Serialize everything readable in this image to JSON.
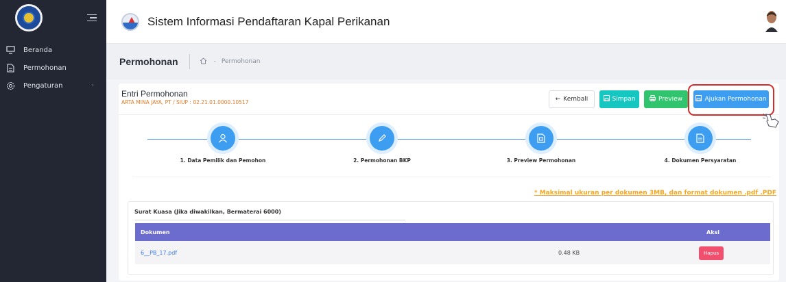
{
  "sidebar": {
    "logo": "emblem-logo",
    "menu_icon": "hamburger-icon",
    "items": [
      {
        "label": "Beranda",
        "icon": "monitor-icon"
      },
      {
        "label": "Permohonan",
        "icon": "document-icon"
      },
      {
        "label": "Pengaturan",
        "icon": "gear-icon"
      }
    ]
  },
  "topbar": {
    "title": "Sistem Informasi Pendaftaran Kapal Perikanan"
  },
  "breadcrumb": {
    "title": "Permohonan",
    "item": "Permohonan"
  },
  "card": {
    "title": "Entri Permohonan",
    "subtitle": "ARTA MINA JAYA, PT / SIUP : 02.21.01.0000.10517",
    "buttons": {
      "kembali": "Kembali",
      "simpan": "Simpan",
      "preview": "Preview",
      "ajukan": "Ajukan Permohonan"
    }
  },
  "steps": [
    {
      "label": "1. Data Pemilik dan Pemohon",
      "icon": "user-icon"
    },
    {
      "label": "2. Permohonan BKP",
      "icon": "pencil-icon"
    },
    {
      "label": "3. Preview Permohonan",
      "icon": "file-icon"
    },
    {
      "label": "4. Dokumen Persyaratan",
      "icon": "file-text-icon"
    }
  ],
  "note": "* Maksimal ukuran per dokumen 3MB, dan format dokumen .pdf .PDF",
  "document_section": {
    "title": "Surat Kuasa (Jika diwakilkan, Bermaterai 6000)",
    "columns": [
      "Dokumen",
      "Aksi"
    ],
    "rows": [
      {
        "file": "6__PB_17.pdf",
        "size": "0.48 KB",
        "action": "Hapus"
      }
    ]
  },
  "colors": {
    "sidebar_bg": "#232734",
    "primary": "#3d9df0",
    "table_header": "#6c6bce",
    "danger": "#f0506e",
    "warning": "#f5a623"
  }
}
